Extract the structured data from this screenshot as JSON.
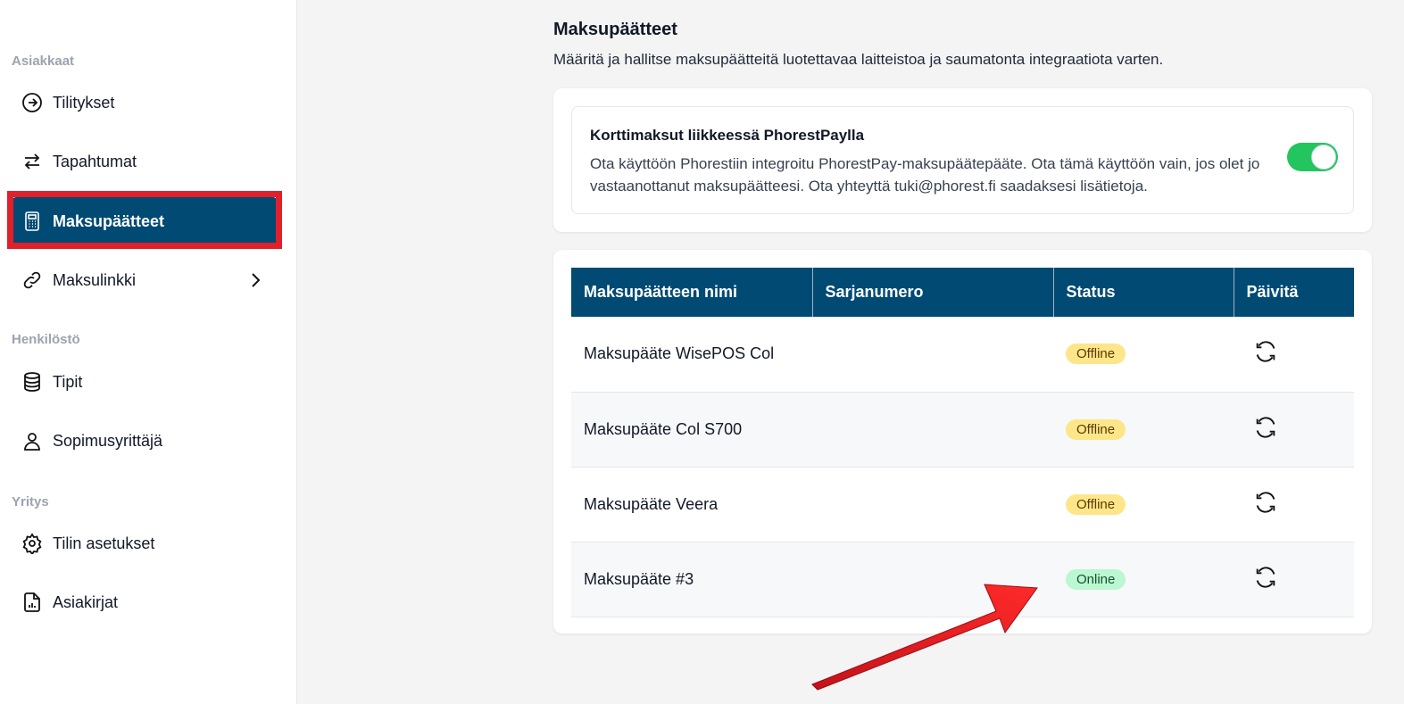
{
  "sidebar": {
    "sections": [
      {
        "label": "Asiakkaat"
      },
      {
        "label": "Henkilöstö"
      },
      {
        "label": "Yritys"
      }
    ],
    "items": [
      {
        "label": "Tilitykset",
        "icon": "arrow-circle-icon"
      },
      {
        "label": "Tapahtumat",
        "icon": "swap-arrows-icon"
      },
      {
        "label": "Maksupäätteet",
        "icon": "calculator-icon",
        "active": true
      },
      {
        "label": "Maksulinkki",
        "icon": "link-icon"
      },
      {
        "label": "Tipit",
        "icon": "database-icon"
      },
      {
        "label": "Sopimusyrittäjä",
        "icon": "user-icon"
      },
      {
        "label": "Tilin asetukset",
        "icon": "gear-icon"
      },
      {
        "label": "Asiakirjat",
        "icon": "document-chart-icon"
      }
    ]
  },
  "main": {
    "title": "Maksupäätteet",
    "subtitle": "Määritä ja hallitse maksupäätteitä luotettavaa laitteistoa ja saumatonta integraatiota varten."
  },
  "integration_card": {
    "title": "Korttimaksut liikkeessä PhorestPaylla",
    "description": "Ota käyttöön Phorestiin integroitu PhorestPay-maksupäätepääte. Ota tämä käyttöön vain, jos olet jo vastaanottanut maksupäätteesi. Ota yhteyttä tuki@phorest.fi saadaksesi lisätietoja.",
    "toggle_on": true
  },
  "table": {
    "headers": [
      "Maksupäätteen nimi",
      "Sarjanumero",
      "Status",
      "Päivitä"
    ],
    "rows": [
      {
        "name": "Maksupääte WisePOS Col",
        "serial": "",
        "status": "Offline"
      },
      {
        "name": "Maksupääte Col S700",
        "serial": "",
        "status": "Offline"
      },
      {
        "name": "Maksupääte Veera",
        "serial": "",
        "status": "Offline"
      },
      {
        "name": "Maksupääte #3",
        "serial": "",
        "status": "Online"
      }
    ]
  },
  "colors": {
    "primary": "#004a73",
    "toggle_on": "#22c55e",
    "offline_badge": "#fde68a",
    "online_badge": "#bbf7d0",
    "annotation": "#e1202a"
  }
}
